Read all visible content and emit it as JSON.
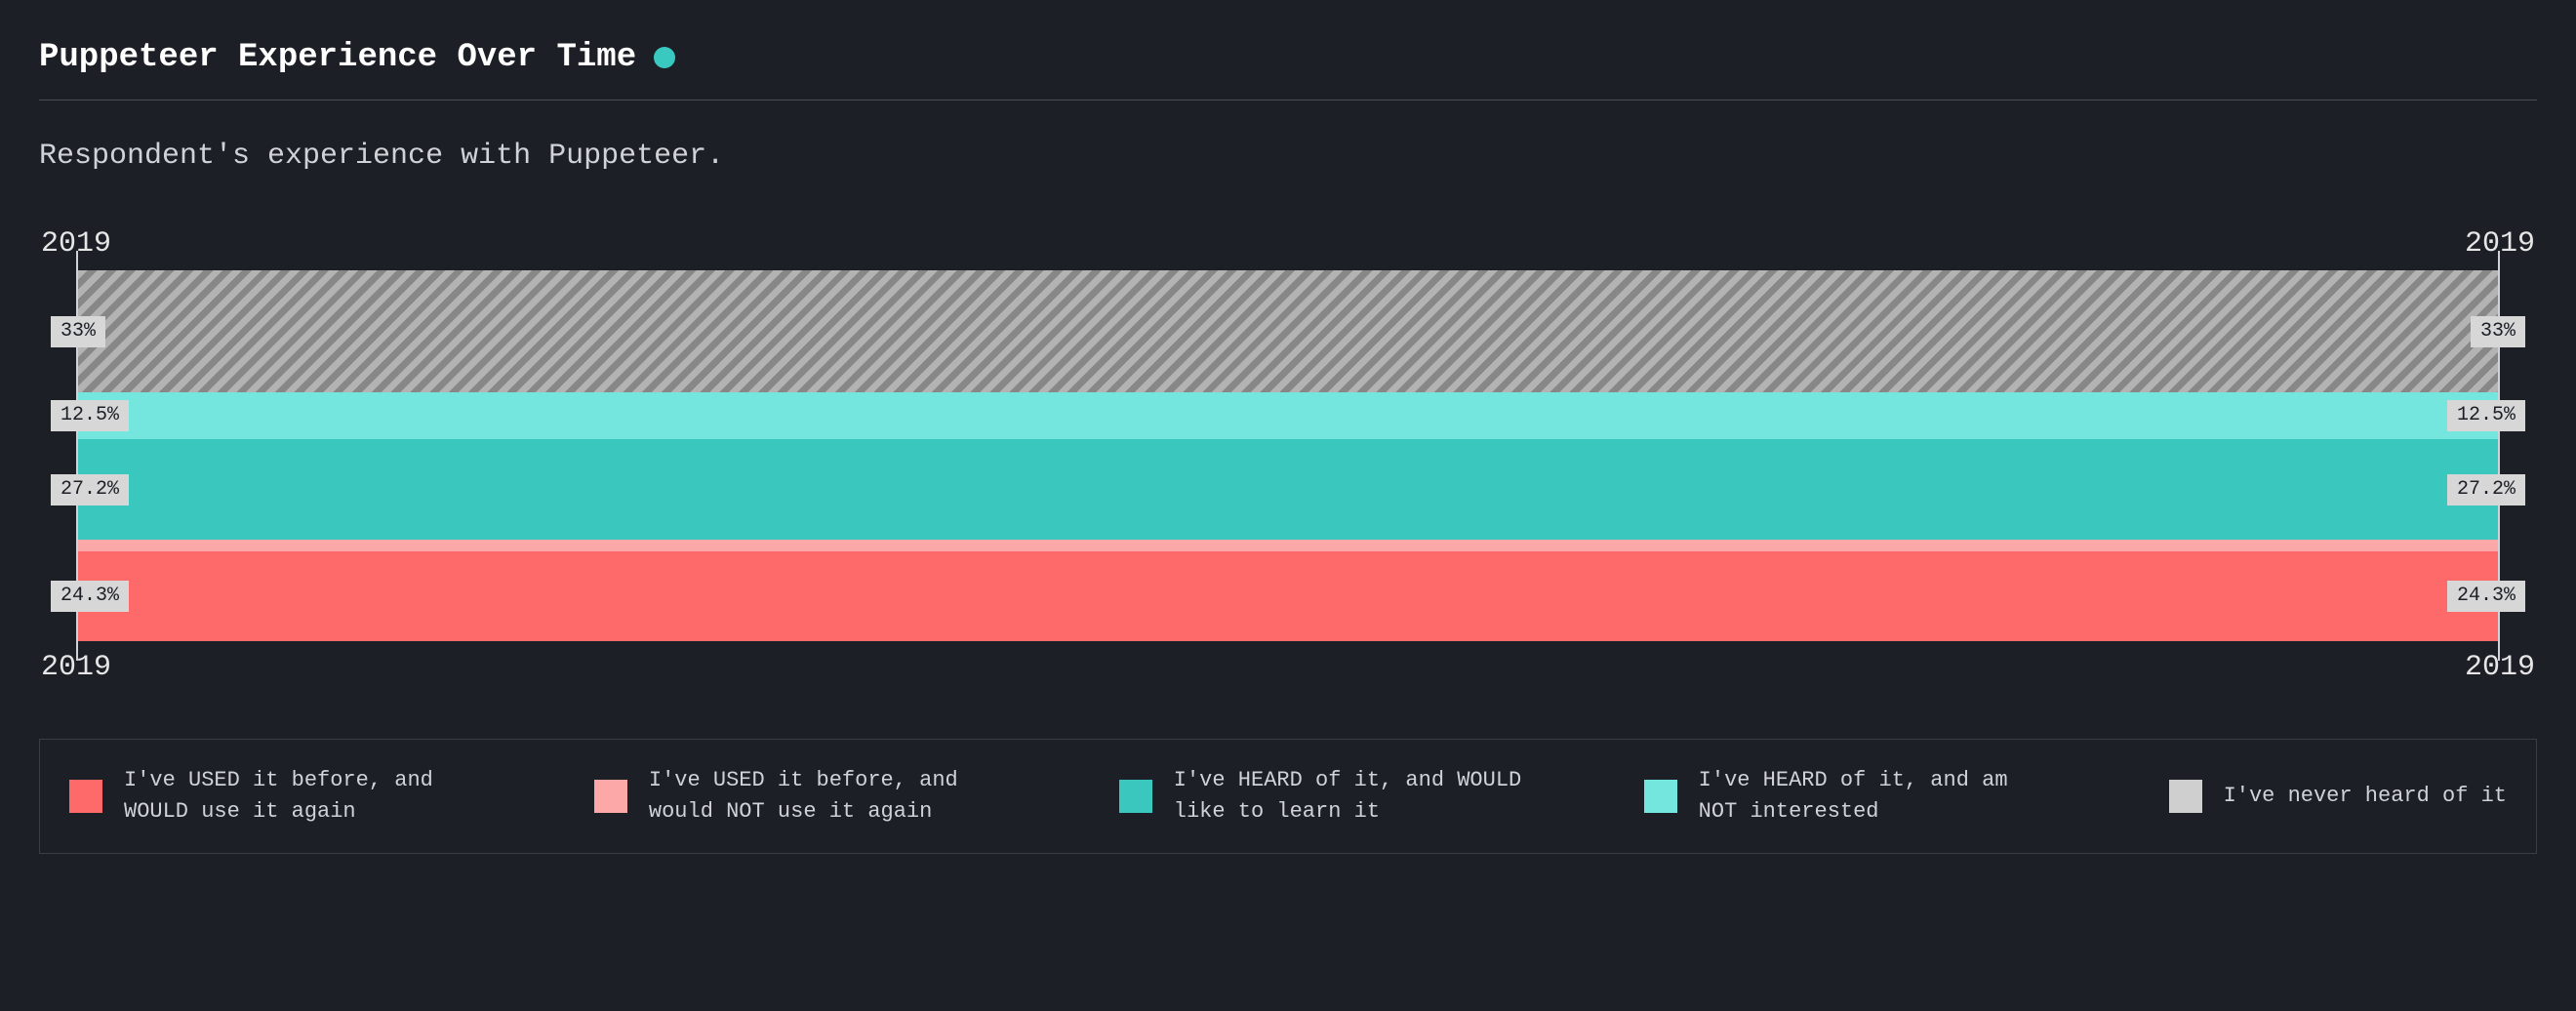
{
  "title": "Puppeteer Experience Over Time",
  "title_dot_color": "#3ac9c0",
  "subtitle": "Respondent's experience with Puppeteer.",
  "axis": {
    "top_left": "2019",
    "top_right": "2019",
    "bottom_left": "2019",
    "bottom_right": "2019"
  },
  "colors": {
    "used_would": "#FE6A6A",
    "used_not": "#FDA8A8",
    "heard_would": "#39C7BE",
    "heard_not": "#74E6DD",
    "never": "#CFCFCF"
  },
  "legend": [
    {
      "key": "used_would",
      "label": "I've USED it before, and WOULD use it again"
    },
    {
      "key": "used_not",
      "label": "I've USED it before, and would NOT use it again"
    },
    {
      "key": "heard_would",
      "label": "I've HEARD of it, and WOULD like to learn it"
    },
    {
      "key": "heard_not",
      "label": "I've HEARD of it, and am NOT interested"
    },
    {
      "key": "never",
      "label": "I've never heard of it"
    }
  ],
  "chart_data": {
    "type": "area",
    "title": "Puppeteer Experience Over Time",
    "xlabel": "",
    "ylabel": "",
    "x": [
      "2019",
      "2019"
    ],
    "ylim": [
      0,
      100
    ],
    "stack_order_top_to_bottom": [
      "never",
      "heard_not",
      "heard_would",
      "used_not",
      "used_would"
    ],
    "series": [
      {
        "key": "never",
        "name": "I've never heard of it",
        "values": [
          33.0,
          33.0
        ],
        "label": "33%"
      },
      {
        "key": "heard_not",
        "name": "I've HEARD of it, and am NOT interested",
        "values": [
          12.5,
          12.5
        ],
        "label": "12.5%"
      },
      {
        "key": "heard_would",
        "name": "I've HEARD of it, and WOULD like to learn it",
        "values": [
          27.2,
          27.2
        ],
        "label": "27.2%"
      },
      {
        "key": "used_not",
        "name": "I've USED it before, and would NOT use it again",
        "values": [
          3.0,
          3.0
        ],
        "label": ""
      },
      {
        "key": "used_would",
        "name": "I've USED it before, and WOULD use it again",
        "values": [
          24.3,
          24.3
        ],
        "label": "24.3%"
      }
    ]
  }
}
